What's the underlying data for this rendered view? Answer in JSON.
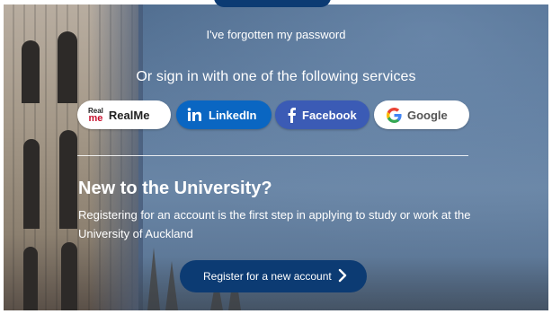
{
  "login": {
    "forgot_password": "I've forgotten my password"
  },
  "alt_signin": {
    "title": "Or sign in with one of the following services",
    "services": [
      {
        "label": "RealMe",
        "icon": "realme-logo-icon"
      },
      {
        "label": "LinkedIn",
        "icon": "linkedin-icon"
      },
      {
        "label": "Facebook",
        "icon": "facebook-icon"
      },
      {
        "label": "Google",
        "icon": "google-icon"
      }
    ],
    "realme_logo_text": [
      "Real",
      "me"
    ]
  },
  "new_user": {
    "title": "New to the University?",
    "description": "Registering for an account is the first step in applying to study or work at the University of Auckland",
    "register_label": "Register for a new account"
  },
  "colors": {
    "primary_navy": "#0c3b73",
    "linkedin": "#0a66c2",
    "facebook": "#3b5bb5",
    "realme_red": "#c8102e"
  }
}
